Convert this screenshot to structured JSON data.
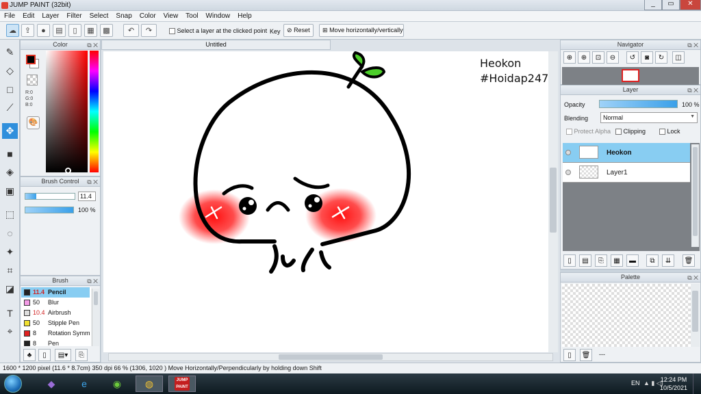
{
  "app": {
    "title": "JUMP PAINT (32bit)"
  },
  "menu": [
    "File",
    "Edit",
    "Layer",
    "Filter",
    "Select",
    "Snap",
    "Color",
    "View",
    "Tool",
    "Window",
    "Help"
  ],
  "toolbar": {
    "select_layer_label": "Select a layer at the clicked point",
    "key_label": "Key",
    "reset_label": "Reset",
    "move_label": "Move horizontally/vertically"
  },
  "color_panel": {
    "title": "Color",
    "r": "R:0",
    "g": "G:0",
    "b": "B:0",
    "main_color": "#000000",
    "sub_color": "#ffffff"
  },
  "brush_control": {
    "title": "Brush Control",
    "size": "11.4",
    "opacity": "100 %",
    "opacity_fraction": 1.0
  },
  "brush_panel": {
    "title": "Brush",
    "items": [
      {
        "size": "11.4",
        "name": "Pencil",
        "color": "#222222",
        "selected": true,
        "red": true
      },
      {
        "size": "50",
        "name": "Blur",
        "color": "#f39be6",
        "selected": false,
        "red": false
      },
      {
        "size": "10.4",
        "name": "Airbrush",
        "color": "#dddddd",
        "selected": false,
        "red": true
      },
      {
        "size": "50",
        "name": "Stipple Pen",
        "color": "#f0e030",
        "selected": false,
        "red": false
      },
      {
        "size": "8",
        "name": "Rotation Symm",
        "color": "#e02020",
        "selected": false,
        "red": false
      },
      {
        "size": "8",
        "name": "Pen",
        "color": "#222222",
        "selected": false,
        "red": false
      }
    ]
  },
  "document": {
    "tab": "Untitled"
  },
  "canvas": {
    "text_line1": "Heokon",
    "text_line2": "#Hoidap247"
  },
  "navigator": {
    "title": "Navigator"
  },
  "layer_panel": {
    "title": "Layer",
    "opacity_label": "Opacity",
    "opacity_value": "100 %",
    "blending_label": "Blending",
    "blending_value": "Normal",
    "protect_alpha": "Protect Alpha",
    "clipping": "Clipping",
    "lock": "Lock",
    "layers": [
      {
        "name": "Heokon",
        "selected": true
      },
      {
        "name": "Layer1",
        "selected": false
      }
    ]
  },
  "palette": {
    "title": "Palette",
    "more": "---"
  },
  "status": {
    "size": "1600 * 1200 pixel",
    "cm": "(11.6 * 8.7cm)",
    "dpi": "350 dpi",
    "zoom": "66 %",
    "coords": "(1306, 1020 )",
    "hint": "Move Horizontally/Perpendicularly by holding down Shift"
  },
  "taskbar": {
    "lang": "EN",
    "time": "12:24 PM",
    "date": "10/5/2021"
  }
}
